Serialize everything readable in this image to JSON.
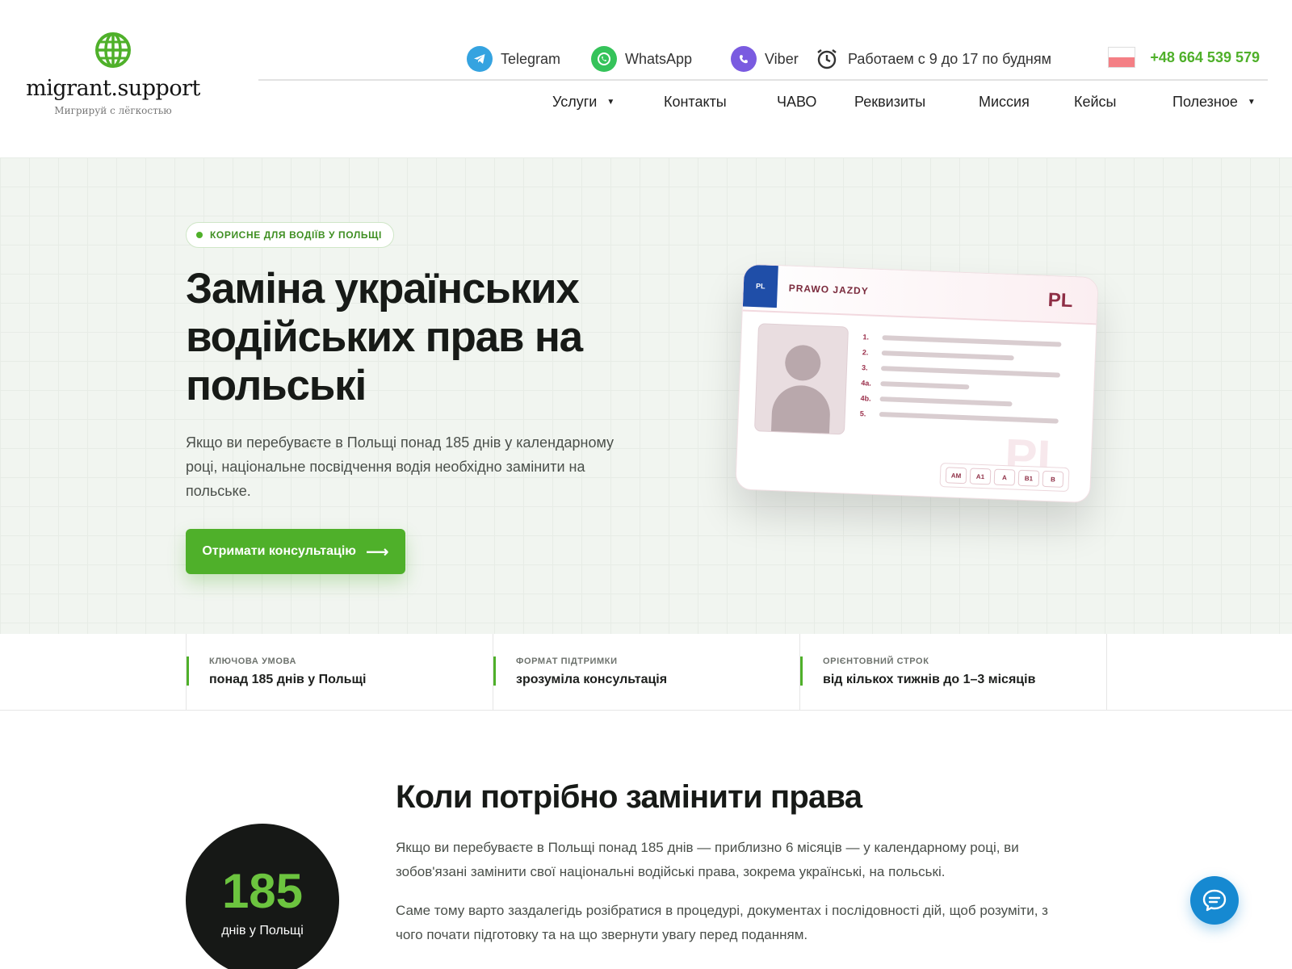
{
  "brand": {
    "name": "migrant.support",
    "tagline": "Мигрируй с лёгкостью",
    "color": "#4fb02a"
  },
  "topbar": {
    "contacts": [
      {
        "label": "Telegram",
        "icon": "telegram-icon",
        "color": "#35a3e0"
      },
      {
        "label": "WhatsApp",
        "icon": "whatsapp-icon",
        "color": "#35c35a"
      },
      {
        "label": "Viber",
        "icon": "viber-icon",
        "color": "#7a5be0"
      }
    ],
    "hours": "Работаем с 9 до 17 по будням",
    "hours_icon": "alarm-clock-icon",
    "phone": "+48 664 539 579",
    "flag_icon": "poland-flag-icon"
  },
  "nav": {
    "items": [
      {
        "label": "Услуги",
        "dropdown": true
      },
      {
        "label": "Контакты",
        "dropdown": false
      },
      {
        "label": "ЧАВО",
        "dropdown": false
      },
      {
        "label": "Реквизиты",
        "dropdown": false
      },
      {
        "label": "Миссия",
        "dropdown": false
      },
      {
        "label": "Кейсы",
        "dropdown": false
      },
      {
        "label": "Полезное",
        "dropdown": true
      }
    ]
  },
  "hero": {
    "pill": "КОРИСНЕ ДЛЯ ВОДІЇВ У ПОЛЬЩІ",
    "title_lines": [
      "Заміна українських",
      "водійських прав на",
      "польські"
    ],
    "text_lines": [
      "Якщо ви перебуваєте в Польщі понад 185 днів у календарному",
      "році, національне посвідчення водія необхідно замінити на",
      "польське."
    ],
    "cta": "Отримати консультацію",
    "cta_arrow": "⟶"
  },
  "license_card": {
    "eu_code": "PL",
    "title": "PRAWO JAZDY",
    "country": "PL",
    "watermark": "PL",
    "rows": [
      "1.",
      "2.",
      "3.",
      "4a.",
      "4b.",
      "5."
    ],
    "categories": [
      "AM",
      "A1",
      "A",
      "B1",
      "B"
    ]
  },
  "stats": [
    {
      "label": "КЛЮЧОВА УМОВА",
      "value": "понад 185 днів у Польщі"
    },
    {
      "label": "ФОРМАТ ПІДТРИМКИ",
      "value": "зрозуміла консультація"
    },
    {
      "label": "ОРІЄНТОВНИЙ СТРОК",
      "value": "від кількох тижнів до 1–3 місяців"
    }
  ],
  "section": {
    "title": "Коли потрібно замінити права",
    "paragraph1_lines": [
      "Якщо ви перебуваєте в Польщі понад 185 днів — приблизно 6 місяців — у календарному році, ви",
      "зобов'язані замінити свої національні водійські права, зокрема українські, на польські."
    ],
    "paragraph2_lines": [
      "Саме тому варто заздалегідь розібратися в процедурі, документах і послідовності дій, щоб розуміти, з",
      "чого почати підготовку та на що звернути увагу перед поданням."
    ],
    "badge_number": "185",
    "badge_caption": "днів у Польщі"
  },
  "chat_widget": {
    "icon": "chat-bubble-icon"
  }
}
